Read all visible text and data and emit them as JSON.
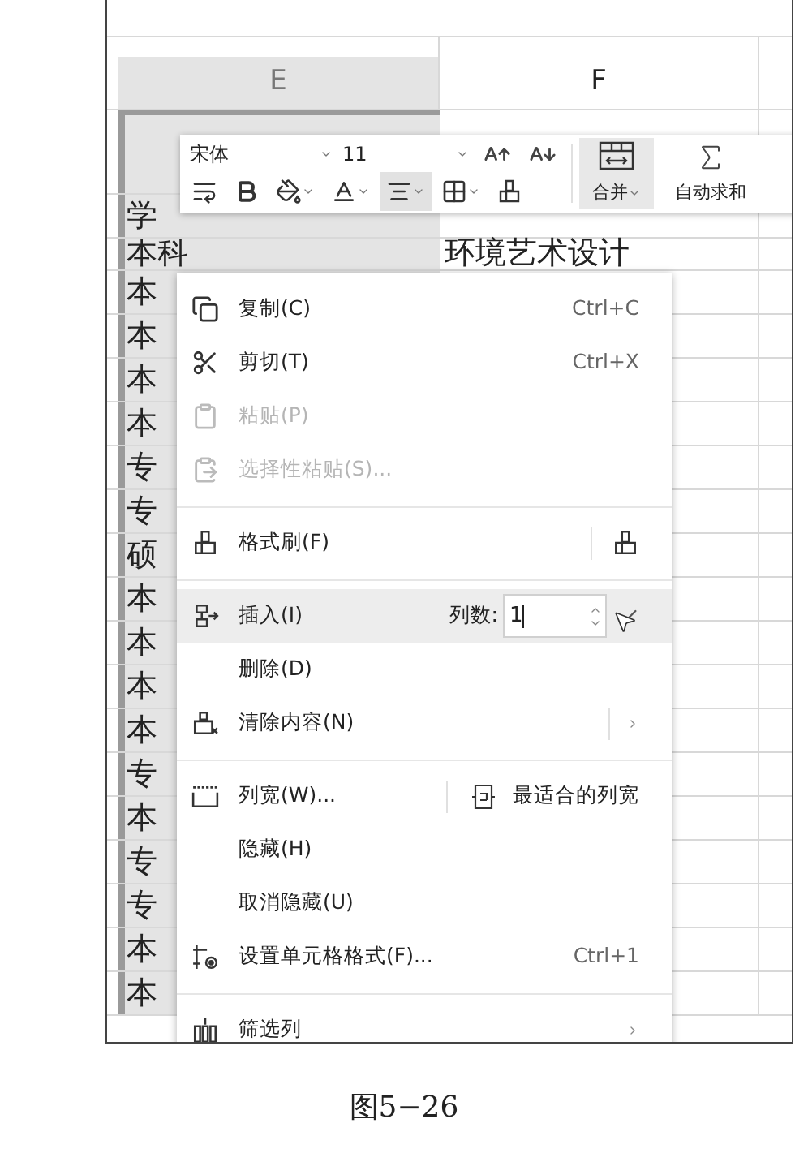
{
  "sheet": {
    "columns": [
      {
        "label": "E",
        "selected": true
      },
      {
        "label": "F",
        "selected": false
      }
    ],
    "rows": [
      {
        "column_e": "学"
      },
      {
        "column_e": "本科",
        "column_f": "环境艺术设计"
      },
      {
        "column_e": "本"
      },
      {
        "column_e": "本"
      },
      {
        "column_e": "本"
      },
      {
        "column_e": "本"
      },
      {
        "column_e": "专"
      },
      {
        "column_e": "专"
      },
      {
        "column_e": "硕"
      },
      {
        "column_e": "本"
      },
      {
        "column_e": "本"
      },
      {
        "column_e": "本"
      },
      {
        "column_e": "本"
      },
      {
        "column_e": "专"
      },
      {
        "column_e": "本"
      },
      {
        "column_e": "专"
      },
      {
        "column_e": "专"
      },
      {
        "column_e": "本"
      },
      {
        "column_e": "本"
      }
    ]
  },
  "mini_toolbar": {
    "font": "宋体",
    "size": "11",
    "tools": [
      {
        "kind": "wrap",
        "selected": false
      },
      {
        "kind": "bold",
        "selected": false
      },
      {
        "kind": "fill",
        "selected": false
      },
      {
        "kind": "font_color",
        "selected": false
      },
      {
        "kind": "align",
        "selected": true
      },
      {
        "kind": "border",
        "selected": false
      },
      {
        "kind": "brush",
        "selected": false
      }
    ],
    "merge": {
      "label": "合并",
      "selected": true
    },
    "autosum": {
      "label": "自动求和"
    }
  },
  "context_menu": {
    "items": [
      {
        "kind": "copy",
        "label": "复制(C)",
        "shortcut": "Ctrl+C",
        "disabled": false,
        "selected": false
      },
      {
        "kind": "cut",
        "label": "剪切(T)",
        "shortcut": "Ctrl+X",
        "disabled": false,
        "selected": false
      },
      {
        "kind": "paste",
        "label": "粘贴(P)",
        "disabled": true,
        "selected": false
      },
      {
        "kind": "paste_special",
        "label": "选择性粘贴(S)...",
        "disabled": true,
        "selected": false
      },
      {
        "kind": "separator"
      },
      {
        "kind": "format_painter",
        "label": "格式刷(F)",
        "disabled": false,
        "selected": false
      },
      {
        "kind": "separator"
      },
      {
        "kind": "insert",
        "label": "插入(I)",
        "count_label": "列数:",
        "count_value": "1",
        "disabled": false,
        "selected": true
      },
      {
        "kind": "delete",
        "label": "删除(D)",
        "disabled": false,
        "selected": false
      },
      {
        "kind": "clear",
        "label": "清除内容(N)",
        "disabled": false,
        "selected": false
      },
      {
        "kind": "separator"
      },
      {
        "kind": "column_width",
        "label": "列宽(W)...",
        "extra_label": "最适合的列宽",
        "disabled": false,
        "selected": false
      },
      {
        "kind": "hide",
        "label": "隐藏(H)",
        "disabled": false,
        "selected": false
      },
      {
        "kind": "unhide",
        "label": "取消隐藏(U)",
        "disabled": false,
        "selected": false
      },
      {
        "kind": "format_cells",
        "label": "设置单元格格式(F)...",
        "shortcut": "Ctrl+1",
        "disabled": false,
        "selected": false
      },
      {
        "kind": "separator"
      },
      {
        "kind": "filter",
        "label": "筛选列",
        "disabled": false,
        "selected": false
      }
    ]
  },
  "caption": "图5−26"
}
